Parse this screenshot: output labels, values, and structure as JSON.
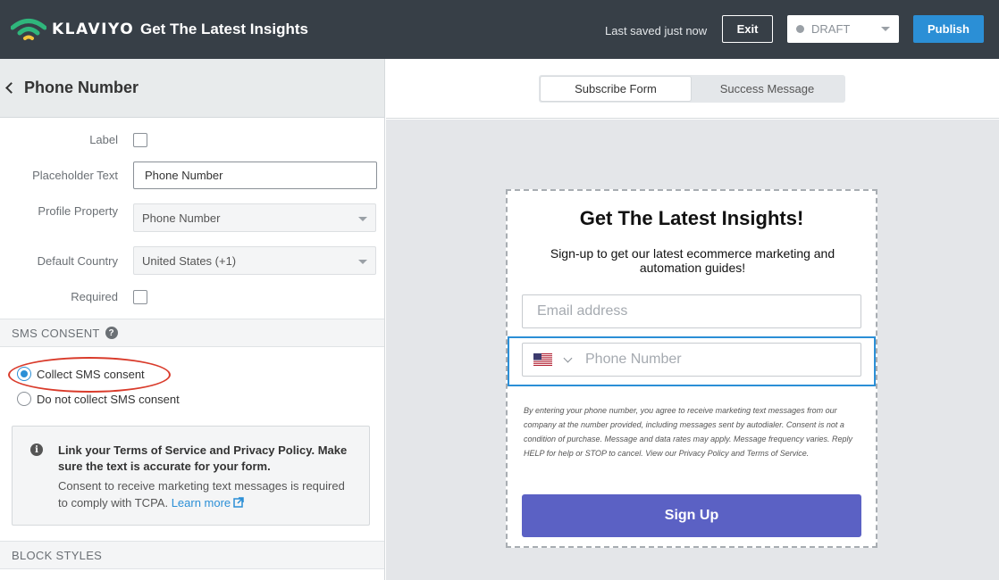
{
  "topbar": {
    "brand": "KLAVIYO",
    "title": "Get The Latest Insights",
    "saved_status": "Last saved just now",
    "exit_label": "Exit",
    "status_value": "DRAFT",
    "publish_label": "Publish",
    "colors": {
      "bar": "#373f47",
      "logo_green": "#2fb67c",
      "logo_yellow": "#f3c33b",
      "publish": "#2b8fd6"
    }
  },
  "panel": {
    "title": "Phone Number",
    "fields": {
      "label_label": "Label",
      "label_checked": false,
      "placeholder_label": "Placeholder Text",
      "placeholder_value": "Phone Number",
      "profile_property_label": "Profile Property",
      "profile_property_value": "Phone Number",
      "default_country_label": "Default Country",
      "default_country_value": "United States (+1)",
      "required_label": "Required",
      "required_checked": false
    },
    "sms_consent": {
      "heading": "SMS CONSENT",
      "options": [
        {
          "label": "Collect SMS consent",
          "selected": true
        },
        {
          "label": "Do not collect SMS consent",
          "selected": false
        }
      ],
      "info_bold": "Link your Terms of Service and Privacy Policy. Make sure the text is accurate for your form.",
      "info_text": "Consent to receive marketing text messages is required to comply with TCPA.",
      "info_link": "Learn more"
    },
    "block_styles_heading": "BLOCK STYLES"
  },
  "preview": {
    "tabs": [
      {
        "label": "Subscribe Form",
        "active": true
      },
      {
        "label": "Success Message",
        "active": false
      }
    ],
    "form": {
      "title": "Get The Latest Insights!",
      "subtitle": "Sign-up to get our latest ecommerce marketing and automation guides!",
      "email_placeholder": "Email address",
      "phone_placeholder": "Phone Number",
      "disclaimer": "By entering your phone number, you agree to receive marketing text messages from our company at the number provided, including messages sent by autodialer. Consent is not a condition of purchase. Message and data rates may apply. Message frequency varies. Reply HELP for help or STOP to cancel. View our Privacy Policy and Terms of Service.",
      "submit_label": "Sign Up",
      "colors": {
        "submit": "#5b61c4",
        "focus_outline": "#2b8fd6"
      }
    }
  }
}
